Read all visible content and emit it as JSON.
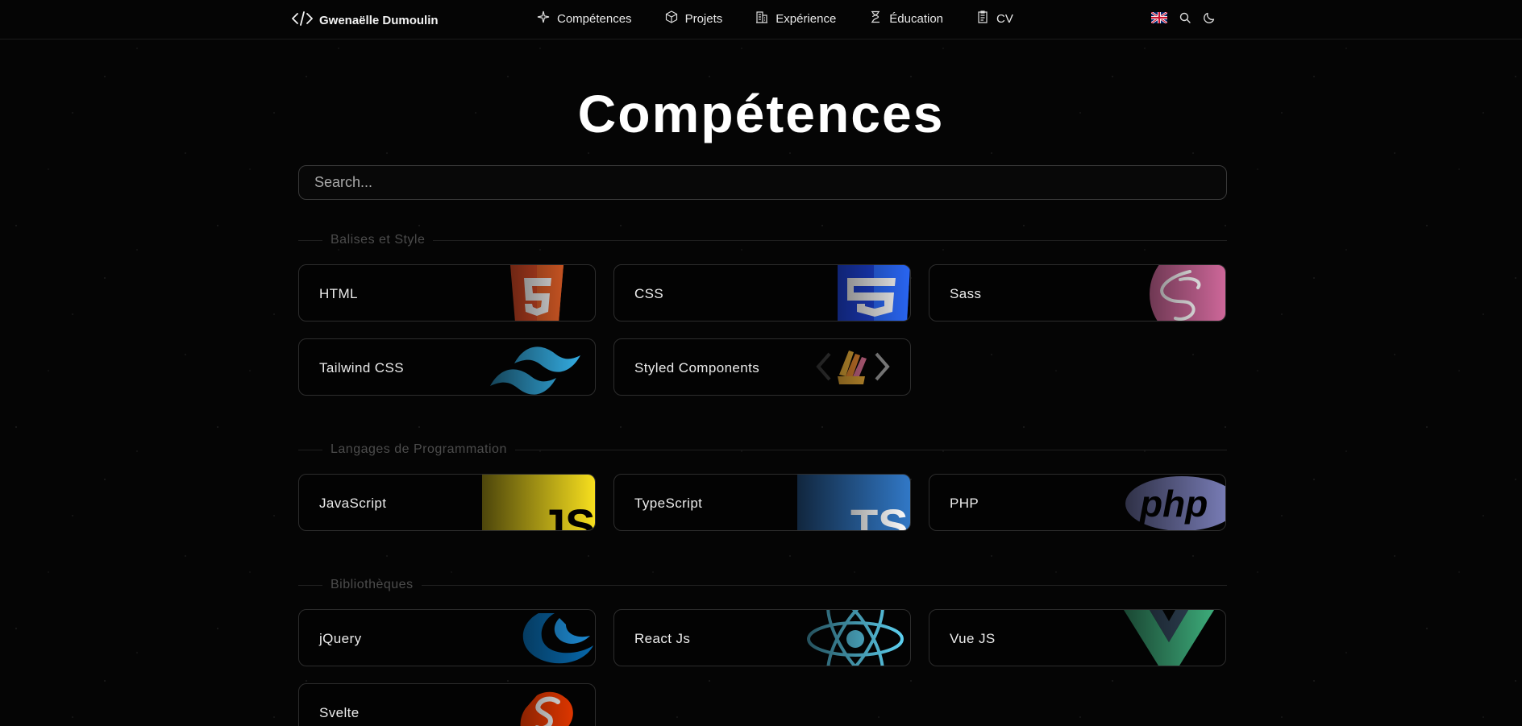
{
  "nav": {
    "brand": "Gwenaëlle Dumoulin",
    "links": [
      {
        "label": "Compétences",
        "icon": "sparkle-icon"
      },
      {
        "label": "Projets",
        "icon": "cube-icon"
      },
      {
        "label": "Expérience",
        "icon": "building-icon"
      },
      {
        "label": "Éducation",
        "icon": "graduation-icon"
      },
      {
        "label": "CV",
        "icon": "document-icon"
      }
    ],
    "tools": [
      "uk-flag-icon",
      "search-icon",
      "moon-icon"
    ]
  },
  "page": {
    "title": "Compétences",
    "search_placeholder": "Search..."
  },
  "sections": [
    {
      "label": "Balises et Style",
      "skills": [
        {
          "name": "HTML",
          "icon": "html5-icon",
          "color": "#e44d26"
        },
        {
          "name": "CSS",
          "icon": "css3-icon",
          "color": "#264de4"
        },
        {
          "name": "Sass",
          "icon": "sass-icon",
          "color": "#cd6799"
        },
        {
          "name": "Tailwind CSS",
          "icon": "tailwind-icon",
          "color": "#38bdf8"
        },
        {
          "name": "Styled Components",
          "icon": "styled-components-icon",
          "color": "#db7093"
        }
      ]
    },
    {
      "label": "Langages de Programmation",
      "skills": [
        {
          "name": "JavaScript",
          "icon": "javascript-icon",
          "color": "#f7df1e"
        },
        {
          "name": "TypeScript",
          "icon": "typescript-icon",
          "color": "#3178c6"
        },
        {
          "name": "PHP",
          "icon": "php-icon",
          "color": "#777bb4"
        }
      ]
    },
    {
      "label": "Bibliothèques",
      "skills": [
        {
          "name": "jQuery",
          "icon": "jquery-icon",
          "color": "#0769ad"
        },
        {
          "name": "React Js",
          "icon": "react-icon",
          "color": "#61dafb"
        },
        {
          "name": "Vue JS",
          "icon": "vue-icon",
          "color": "#41b883"
        },
        {
          "name": "Svelte",
          "icon": "svelte-icon",
          "color": "#ff3e00"
        }
      ]
    }
  ]
}
